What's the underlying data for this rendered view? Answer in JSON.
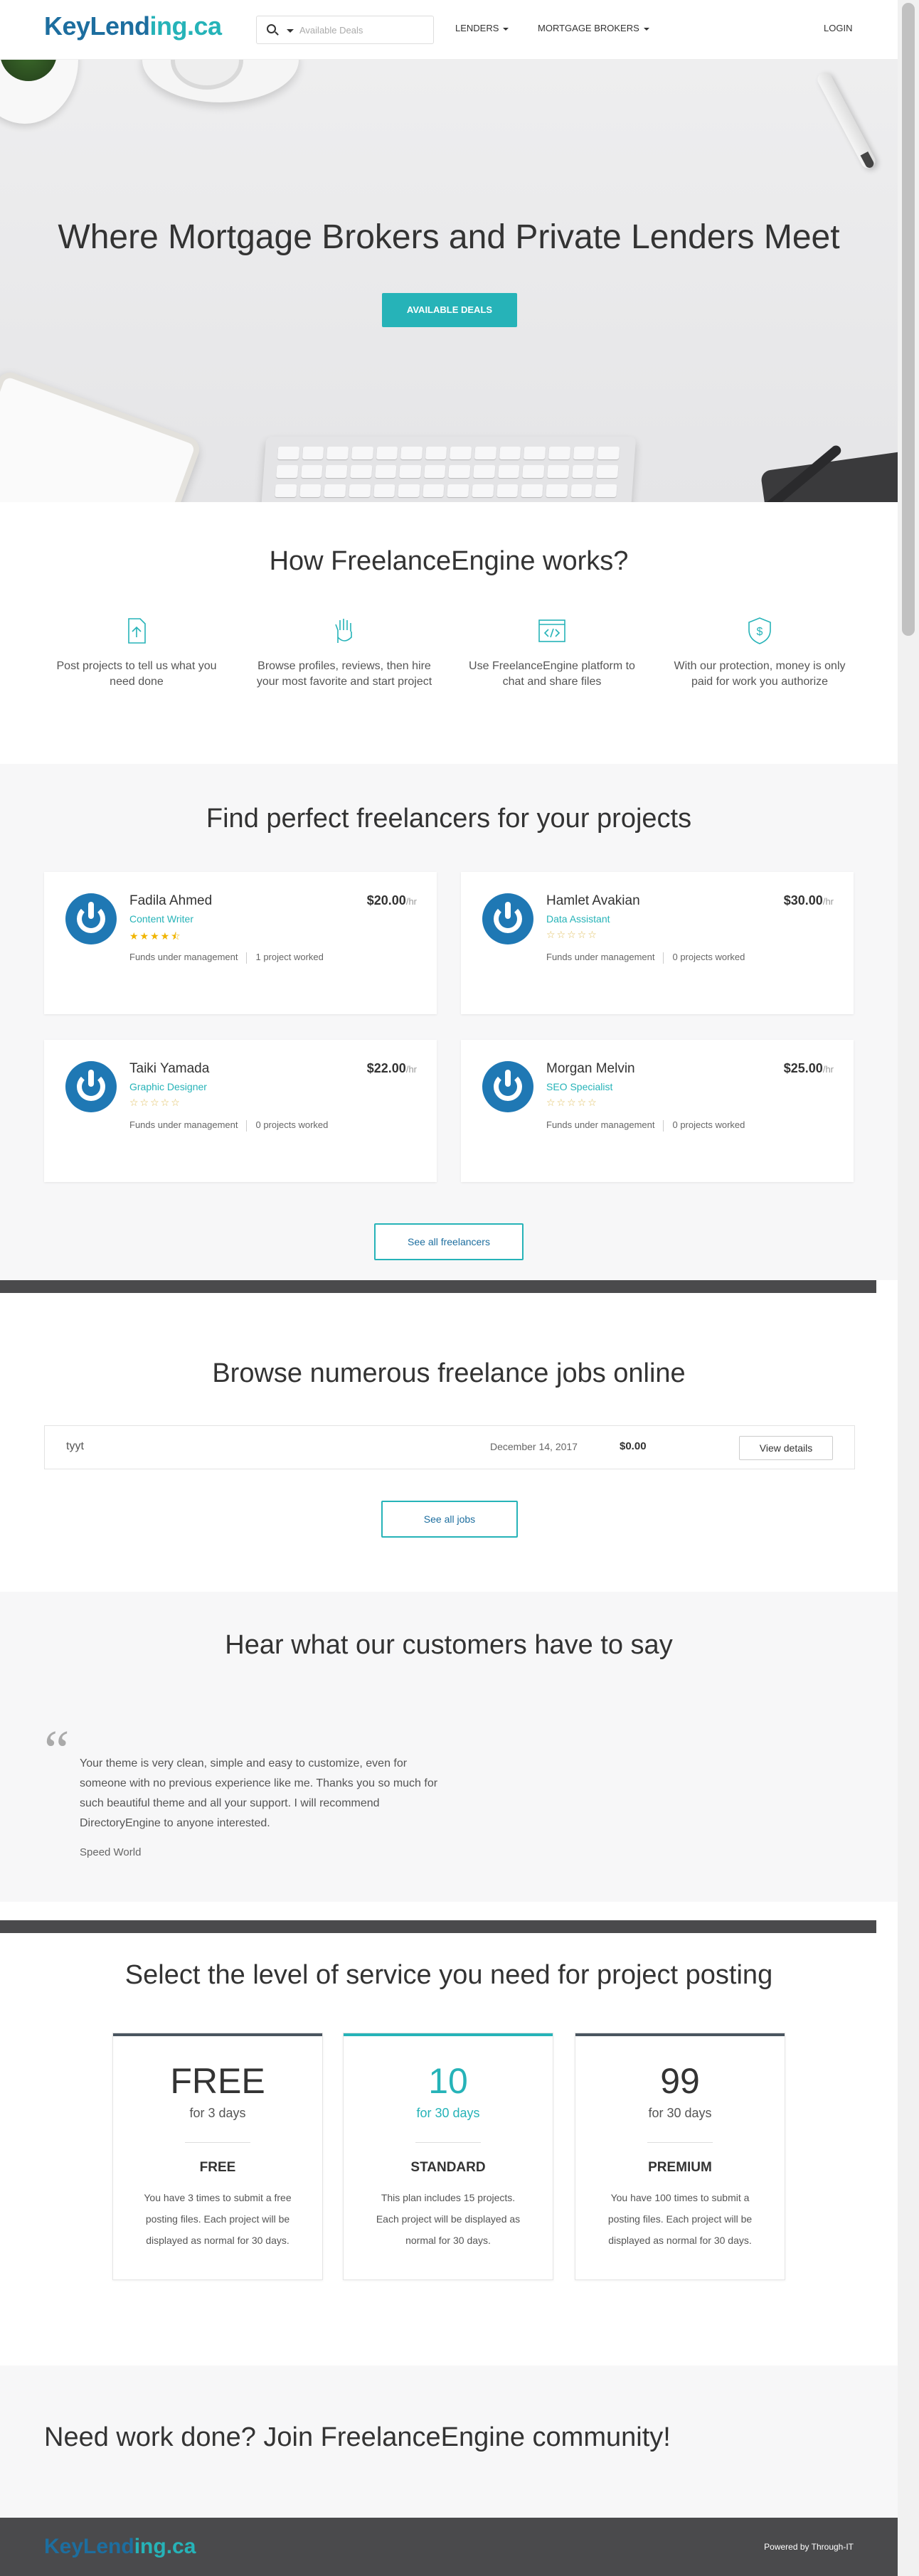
{
  "header": {
    "logo_prefix": "KeyLend",
    "logo_mid": "ing",
    "logo_suffix": ".ca",
    "search_placeholder": "Available Deals",
    "nav": [
      "LENDERS",
      "MORTGAGE BROKERS"
    ],
    "login": "LOGIN"
  },
  "hero": {
    "title": "Where Mortgage Brokers and Private Lenders Meet",
    "button": "AVAILABLE DEALS"
  },
  "how": {
    "title": "How FreelanceEngine works?",
    "steps": [
      {
        "icon": "upload-icon",
        "text": "Post projects to tell us what you need done"
      },
      {
        "icon": "hand-icon",
        "text": "Browse profiles, reviews, then hire your most favorite and start project"
      },
      {
        "icon": "code-icon",
        "text": "Use FreelanceEngine platform to chat and share files"
      },
      {
        "icon": "shield-dollar-icon",
        "text": "With our protection, money is only paid for work you authorize"
      }
    ]
  },
  "freelancers": {
    "title": "Find perfect freelancers for your projects",
    "items": [
      {
        "name": "Fadila Ahmed",
        "role": "Content Writer",
        "rating": 4.5,
        "rate": "$20.00",
        "unit": "/hr",
        "funds": "Funds under management",
        "projects": "1 project worked"
      },
      {
        "name": "Hamlet Avakian",
        "role": "Data Assistant",
        "rating": 0,
        "rate": "$30.00",
        "unit": "/hr",
        "funds": "Funds under management",
        "projects": "0 projects worked"
      },
      {
        "name": "Taiki Yamada",
        "role": "Graphic Designer",
        "rating": 0,
        "rate": "$22.00",
        "unit": "/hr",
        "funds": "Funds under management",
        "projects": "0 projects worked"
      },
      {
        "name": "Morgan Melvin",
        "role": "SEO Specialist",
        "rating": 0,
        "rate": "$25.00",
        "unit": "/hr",
        "funds": "Funds under management",
        "projects": "0 projects worked"
      }
    ],
    "see_all": "See all freelancers"
  },
  "jobs": {
    "title": "Browse numerous freelance jobs online",
    "items": [
      {
        "title": "tyyt",
        "date": "December 14, 2017",
        "price": "$0.00",
        "action": "View details"
      }
    ],
    "see_all": "See all jobs"
  },
  "testimonials": {
    "title": "Hear what our customers have to say",
    "quote": "Your theme is very clean, simple and easy to customize, even for someone with no previous experience like me. Thanks you so much for such beautiful theme and all your support. I will recommend DirectoryEngine to anyone interested.",
    "author": "Speed World"
  },
  "pricing": {
    "title": "Select the level of service you need for project posting",
    "plans": [
      {
        "price": "FREE",
        "period": "for 3 days",
        "name": "FREE",
        "desc": "You have 3 times to submit a free posting files. Each project will be displayed as normal for 30 days."
      },
      {
        "price": "10",
        "period": "for 30 days",
        "name": "STANDARD",
        "desc": "This plan includes 15 projects. Each project will be displayed as normal for 30 days."
      },
      {
        "price": "99",
        "period": "for 30 days",
        "name": "PREMIUM",
        "desc": "You have 100 times to submit a posting files. Each project will be displayed as normal for 30 days."
      }
    ]
  },
  "cta": {
    "title": "Need work done? Join FreelanceEngine community!"
  },
  "footer": {
    "powered": "Powered by Through-IT"
  },
  "colors": {
    "brand_blue": "#1d6e9f",
    "accent_teal": "#26b3b8",
    "footer_dark": "#4a4a4c"
  }
}
